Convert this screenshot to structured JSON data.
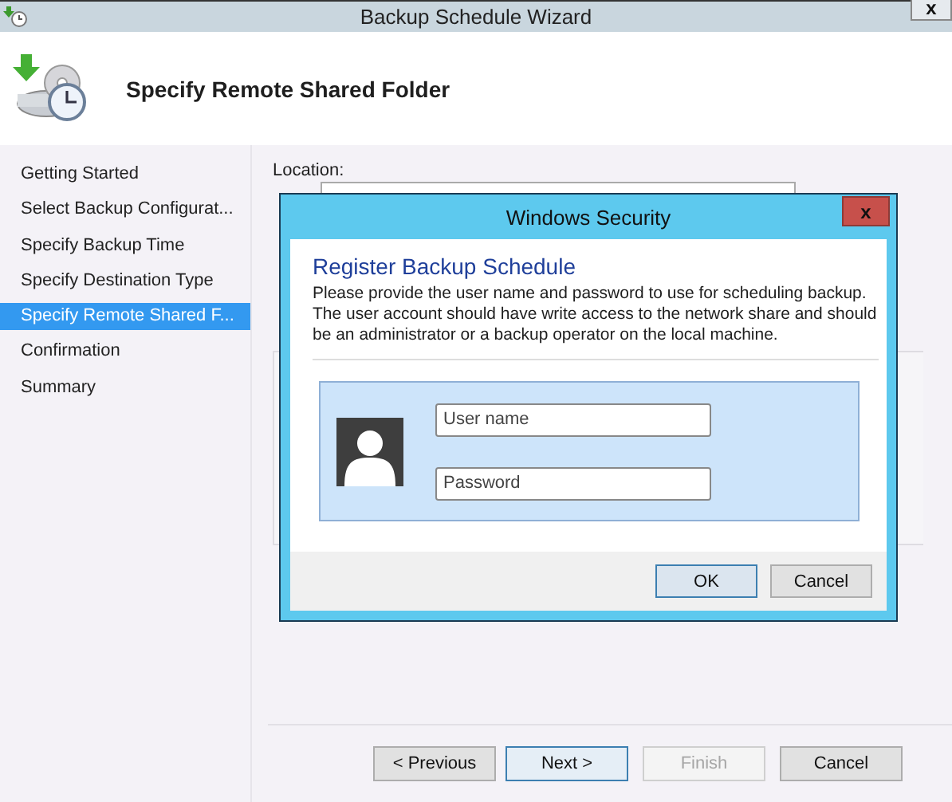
{
  "window": {
    "title": "Backup Schedule Wizard",
    "close": "x"
  },
  "header": {
    "title": "Specify Remote Shared Folder"
  },
  "steps": [
    {
      "label": "Getting Started",
      "selected": false
    },
    {
      "label": "Select Backup Configurat...",
      "selected": false
    },
    {
      "label": "Specify Backup Time",
      "selected": false
    },
    {
      "label": "Specify Destination Type",
      "selected": false
    },
    {
      "label": "Specify Remote Shared F...",
      "selected": true
    },
    {
      "label": "Confirmation",
      "selected": false
    },
    {
      "label": "Summary",
      "selected": false
    }
  ],
  "location": {
    "label": "Location:"
  },
  "buttons": [
    {
      "label": "< Previous",
      "disabled": false,
      "default": false
    },
    {
      "label": "Next >",
      "disabled": false,
      "default": true
    },
    {
      "label": "Finish",
      "disabled": true,
      "default": false
    },
    {
      "label": "Cancel",
      "disabled": false,
      "default": false
    }
  ],
  "dialog": {
    "title": "Windows Security",
    "close": "x",
    "heading": "Register Backup Schedule",
    "message": "Please provide the user name and password to use for scheduling backup. The user account should have write access to the network share and should be an administrator or a backup operator on the local machine.",
    "fields": [
      {
        "placeholder": "User name"
      },
      {
        "placeholder": "Password"
      }
    ],
    "buttons": [
      {
        "label": "OK",
        "default": true
      },
      {
        "label": "Cancel",
        "default": false
      }
    ]
  }
}
